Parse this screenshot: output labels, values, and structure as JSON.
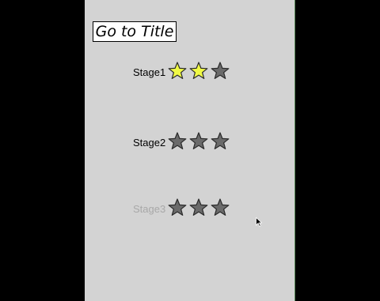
{
  "title_button": {
    "label": "Go to Title"
  },
  "colors": {
    "star_filled": "#f0fa46",
    "star_empty": "#6a6a6a",
    "label_locked": "#a8a8a8",
    "panel_bg": "#d3d3d3"
  },
  "stages": [
    {
      "label": "Stage1",
      "stars_earned": 2,
      "stars_total": 3,
      "unlocked": true
    },
    {
      "label": "Stage2",
      "stars_earned": 0,
      "stars_total": 3,
      "unlocked": true
    },
    {
      "label": "Stage3",
      "stars_earned": 0,
      "stars_total": 3,
      "unlocked": false
    }
  ]
}
